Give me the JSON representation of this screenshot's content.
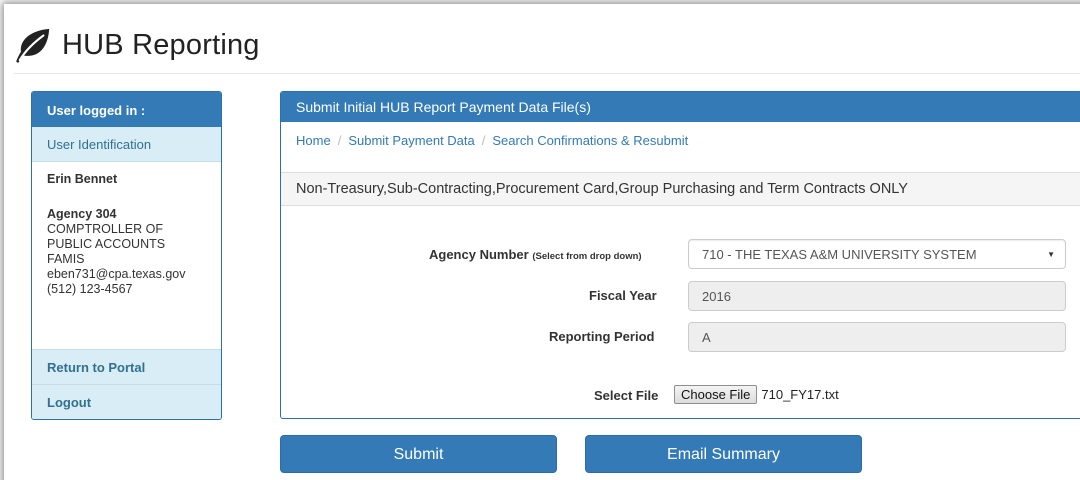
{
  "app": {
    "title": "HUB Reporting",
    "logo_icon": "leaf-icon"
  },
  "sidebar": {
    "header": "User logged in :",
    "subheader": "User Identification",
    "user_name": "Erin Bennet",
    "agency_label": "Agency 304",
    "agency_lines": [
      "COMPTROLLER OF",
      "PUBLIC ACCOUNTS",
      "FAMIS"
    ],
    "email": "eben731@cpa.texas.gov",
    "phone": "(512) 123-4567",
    "links": {
      "return": "Return to Portal",
      "logout": "Logout"
    }
  },
  "panel": {
    "title": "Submit Initial HUB Report Payment Data File(s)",
    "breadcrumb": [
      "Home",
      "Submit Payment Data",
      "Search Confirmations & Resubmit"
    ],
    "breadcrumb_separator": "/",
    "notice": "Non-Treasury,Sub-Contracting,Procurement Card,Group Purchasing and Term Contracts ONLY",
    "form": {
      "agency_label": "Agency Number",
      "agency_hint": "(Select from drop down)",
      "agency_value": "710 - THE TEXAS A&M UNIVERSITY SYSTEM",
      "fiscal_label": "Fiscal Year",
      "fiscal_value": "2016",
      "period_label": "Reporting Period",
      "period_value": "A",
      "file_label": "Select File",
      "file_button": "Choose File",
      "file_name": "710_FY17.txt"
    }
  },
  "actions": {
    "submit": "Submit",
    "email_summary": "Email Summary"
  },
  "colors": {
    "primary": "#337ab7",
    "info_bg": "#d9edf7",
    "info_text": "#31708f"
  }
}
